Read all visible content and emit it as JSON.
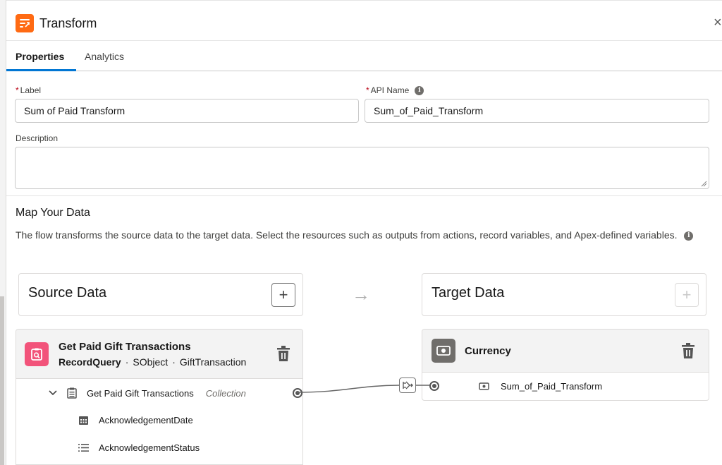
{
  "header": {
    "title": "Transform",
    "close_glyph": "×"
  },
  "tabs": [
    {
      "label": "Properties",
      "active": true
    },
    {
      "label": "Analytics",
      "active": false
    }
  ],
  "form": {
    "label_field": {
      "label": "Label",
      "required_mark": "*",
      "value": "Sum of Paid Transform"
    },
    "api_field": {
      "label": "API Name",
      "required_mark": "*",
      "value": "Sum_of_Paid_Transform",
      "info_glyph": "i"
    },
    "description_field": {
      "label": "Description",
      "value": ""
    }
  },
  "map": {
    "title": "Map Your Data",
    "description": "The flow transforms the source data to the target data. Select the resources such as outputs from actions, record variables, and Apex-defined variables.",
    "info_glyph": "i"
  },
  "source": {
    "title": "Source Data",
    "add_glyph": "+",
    "object": {
      "name": "Get Paid Gift Transactions",
      "type": "RecordQuery",
      "separator": "·",
      "kind": "SObject",
      "sobject": "GiftTransaction",
      "icon_color": "#f2537a"
    },
    "tree": [
      {
        "label": "Get Paid Gift Transactions",
        "note": "Collection",
        "icon": "list-clipboard-icon",
        "expandable": true
      },
      {
        "label": "AcknowledgementDate",
        "icon": "calendar-icon"
      },
      {
        "label": "AcknowledgementStatus",
        "icon": "picklist-icon"
      }
    ]
  },
  "target": {
    "title": "Target Data",
    "add_glyph": "+",
    "object": {
      "name": "Currency",
      "icon_color": "#706e6b"
    },
    "fields": [
      {
        "label": "Sum_of_Paid_Transform",
        "icon": "currency-icon"
      }
    ]
  },
  "colors": {
    "accent": "#0176d3",
    "brand_orange": "#ff6a13",
    "required": "#ba0517"
  }
}
